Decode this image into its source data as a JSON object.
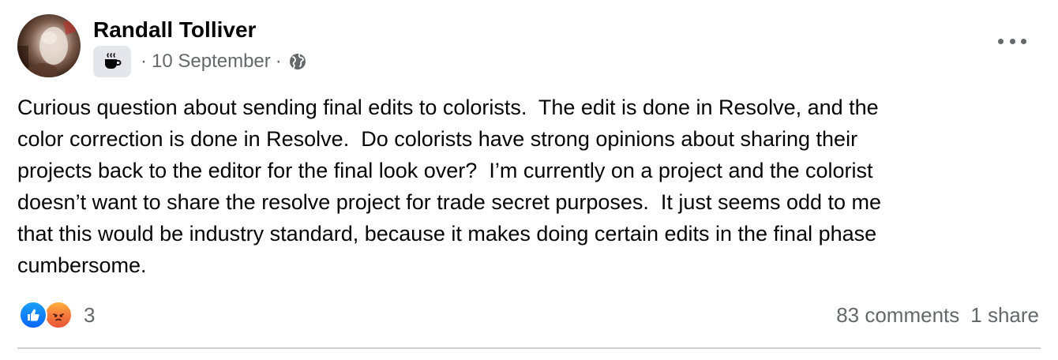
{
  "post": {
    "author": "Randall Tolliver",
    "date": "10 September",
    "separator": "·",
    "badge_icon": "coffee-cup-icon",
    "audience_icon": "globe-icon",
    "more_icon": "more-options-icon",
    "text_lines": [
      "Curious question about sending final edits to colorists.  The edit is done in Resolve, and the",
      "color correction is done in Resolve.  Do colorists have strong opinions about sharing their",
      "projects back to the editor for the final look over?  I’m currently on a project and the colorist",
      "doesn’t want to share the resolve project for trade secret purposes.  It just seems odd to me",
      "that this would be industry standard, because it makes doing certain edits in the final phase",
      "cumbersome."
    ]
  },
  "reactions": {
    "types": [
      "like",
      "angry"
    ],
    "count": "3",
    "like_color": "#0866ff",
    "angry_color": "#f4763b"
  },
  "stats": {
    "comments": "83 comments",
    "shares": "1 share"
  },
  "colors": {
    "text": "#050505",
    "secondary": "#65676b",
    "divider": "#ced0d4"
  }
}
